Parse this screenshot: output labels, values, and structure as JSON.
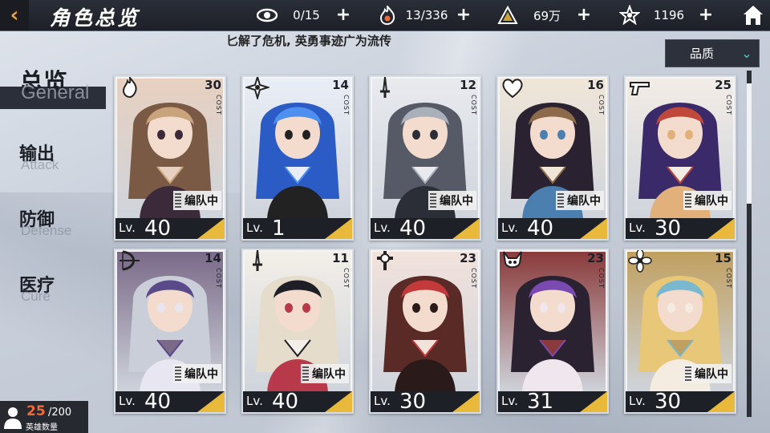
{
  "header": {
    "title": "角色总览",
    "back_icon": "back-arrow-icon",
    "home_icon": "home-icon",
    "resources": [
      {
        "icon": "eye-icon",
        "value": "0/15"
      },
      {
        "icon": "flame-icon",
        "value": "13/336"
      },
      {
        "icon": "crystal-icon",
        "value": "69万"
      },
      {
        "icon": "star-icon",
        "value": "1196"
      }
    ]
  },
  "ticker": "匕解了危机, 英勇事迹广为流传",
  "filter": {
    "label": "品质",
    "icon": "chevron-down-icon"
  },
  "sidebar": {
    "items": [
      {
        "zh": "总览",
        "en": "General",
        "active": true
      },
      {
        "zh": "输出",
        "en": "Attack",
        "active": false
      },
      {
        "zh": "防御",
        "en": "Defense",
        "active": false
      },
      {
        "zh": "医疗",
        "en": "Cure",
        "active": false
      }
    ]
  },
  "hero_count": {
    "current": "25",
    "max": "/200",
    "caption": "英雄数量"
  },
  "card_labels": {
    "cost": "COST",
    "team": "编队中",
    "lv": "Lv."
  },
  "cards": [
    {
      "cost": "30",
      "level": "40",
      "class_icon": "flame-class-icon",
      "in_team": true,
      "palette": [
        "#7a5a44",
        "#c9a37c",
        "#3a2a3a",
        "#e7d0c0"
      ]
    },
    {
      "cost": "14",
      "level": "1",
      "class_icon": "shuriken-class-icon",
      "in_team": false,
      "palette": [
        "#2b5cc6",
        "#4f8ff0",
        "#222",
        "#e9eef6"
      ]
    },
    {
      "cost": "12",
      "level": "40",
      "class_icon": "sword-class-icon",
      "in_team": true,
      "palette": [
        "#555a66",
        "#aab0ba",
        "#2b2e36",
        "#e8eaee"
      ]
    },
    {
      "cost": "16",
      "level": "40",
      "class_icon": "heart-class-icon",
      "in_team": true,
      "palette": [
        "#2a2230",
        "#8c6a4a",
        "#4b7fb0",
        "#f0e6d8"
      ]
    },
    {
      "cost": "25",
      "level": "30",
      "class_icon": "gun-class-icon",
      "in_team": true,
      "palette": [
        "#3b2a6a",
        "#c0483a",
        "#e2b07a",
        "#f2ece6"
      ]
    },
    {
      "cost": "14",
      "level": "40",
      "class_icon": "bow-class-icon",
      "in_team": true,
      "palette": [
        "#c9ced8",
        "#5a4a8a",
        "#e8e6f0",
        "#7a6a88"
      ]
    },
    {
      "cost": "11",
      "level": "40",
      "class_icon": "sword-class-icon",
      "in_team": true,
      "palette": [
        "#e6dccc",
        "#1e1f26",
        "#b83a4a",
        "#f3efe8"
      ]
    },
    {
      "cost": "23",
      "level": "30",
      "class_icon": "cross-class-icon",
      "in_team": false,
      "palette": [
        "#5a2a26",
        "#c23a3a",
        "#2a1a1a",
        "#f2e2dc"
      ]
    },
    {
      "cost": "23",
      "level": "31",
      "class_icon": "demon-class-icon",
      "in_team": false,
      "palette": [
        "#2a2230",
        "#7a4ab0",
        "#efe6ee",
        "#8a3a3a"
      ]
    },
    {
      "cost": "15",
      "level": "30",
      "class_icon": "flower-class-icon",
      "in_team": true,
      "palette": [
        "#e8c878",
        "#7ab8d0",
        "#f4ece0",
        "#c0a060"
      ]
    }
  ]
}
